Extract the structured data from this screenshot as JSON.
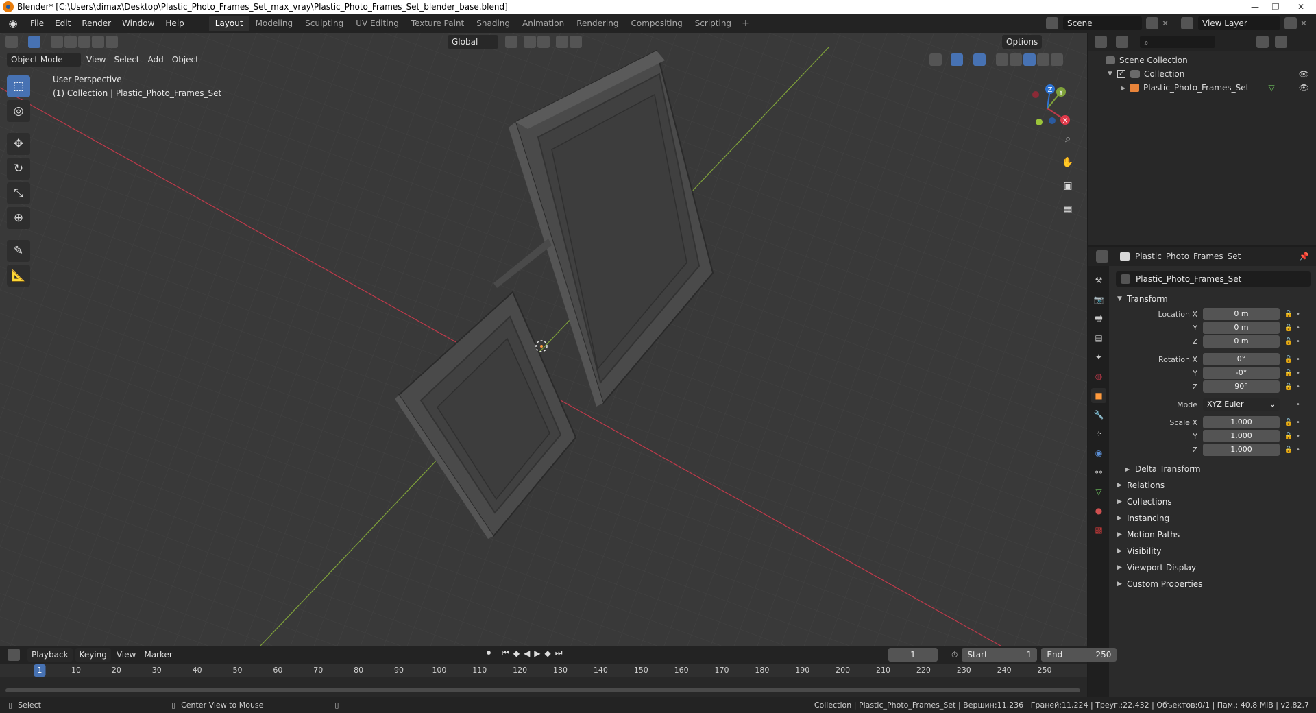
{
  "window": {
    "title": "Blender* [C:\\Users\\dimax\\Desktop\\Plastic_Photo_Frames_Set_max_vray\\Plastic_Photo_Frames_Set_blender_base.blend]",
    "minimize": "—",
    "maximize": "❐",
    "close": "✕"
  },
  "menu": [
    "File",
    "Edit",
    "Render",
    "Window",
    "Help"
  ],
  "workspaces": [
    "Layout",
    "Modeling",
    "Sculpting",
    "UV Editing",
    "Texture Paint",
    "Shading",
    "Animation",
    "Rendering",
    "Compositing",
    "Scripting"
  ],
  "workspace_add": "+",
  "scene": {
    "label": "Scene",
    "view_layer": "View Layer"
  },
  "viewport": {
    "transform_orientation": "Global",
    "options": "Options",
    "mode": "Object Mode",
    "menus": [
      "View",
      "Select",
      "Add",
      "Object"
    ],
    "info_line1": "User Perspective",
    "info_line2": "(1) Collection | Plastic_Photo_Frames_Set"
  },
  "gizmo_labels": {
    "x": "X",
    "y": "Y",
    "z": "Z"
  },
  "outliner": {
    "scene_collection": "Scene Collection",
    "collection": "Collection",
    "object": "Plastic_Photo_Frames_Set"
  },
  "properties": {
    "header_name": "Plastic_Photo_Frames_Set",
    "object_name": "Plastic_Photo_Frames_Set",
    "transform_title": "Transform",
    "location": {
      "label_x": "Location X",
      "label_y": "Y",
      "label_z": "Z",
      "x": "0 m",
      "y": "0 m",
      "z": "0 m"
    },
    "rotation": {
      "label_x": "Rotation X",
      "label_y": "Y",
      "label_z": "Z",
      "x": "0°",
      "y": "-0°",
      "z": "90°"
    },
    "mode": {
      "label": "Mode",
      "value": "XYZ Euler"
    },
    "scale": {
      "label_x": "Scale X",
      "label_y": "Y",
      "label_z": "Z",
      "x": "1.000",
      "y": "1.000",
      "z": "1.000"
    },
    "delta_transform": "Delta Transform",
    "panels": [
      "Relations",
      "Collections",
      "Instancing",
      "Motion Paths",
      "Visibility",
      "Viewport Display",
      "Custom Properties"
    ]
  },
  "timeline": {
    "menus": [
      "Playback",
      "Keying",
      "View",
      "Marker"
    ],
    "current_frame": "1",
    "start_label": "Start",
    "start": "1",
    "end_label": "End",
    "end": "250",
    "ticks": [
      "1",
      "10",
      "20",
      "30",
      "40",
      "50",
      "60",
      "70",
      "80",
      "90",
      "100",
      "110",
      "120",
      "130",
      "140",
      "150",
      "160",
      "170",
      "180",
      "190",
      "200",
      "210",
      "220",
      "230",
      "240",
      "250"
    ]
  },
  "statusbar": {
    "select": "Select",
    "center_view": "Center View to Mouse",
    "stats": "Collection | Plastic_Photo_Frames_Set | Вершин:11,236 | Граней:11,224 | Треуг.:22,432 | Объектов:0/1 | Пам.: 40.8 MiB | v2.82.7"
  },
  "colors": {
    "accent": "#4772b3",
    "object_orange": "#ff9a3c",
    "x_axis": "#c0394a",
    "y_axis": "#7fa23a",
    "z_axis": "#2e74d4"
  }
}
